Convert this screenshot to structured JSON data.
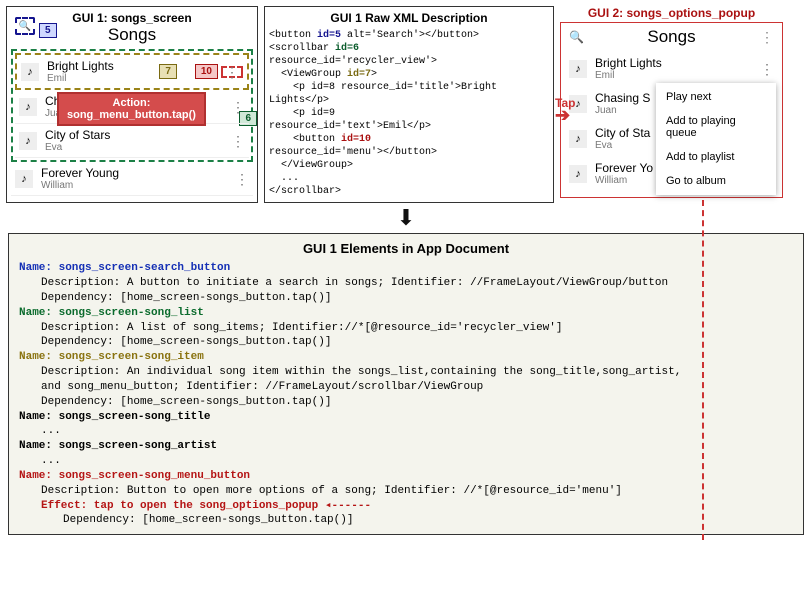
{
  "gui1": {
    "title": "GUI 1: songs_screen",
    "subtitle": "Songs",
    "badges": {
      "b5": "5",
      "b7": "7",
      "b10": "10",
      "b6": "6"
    },
    "action_label": "Action:\nsong_menu_button.tap()",
    "songs": [
      {
        "title": "Bright Lights",
        "artist": "Emil"
      },
      {
        "title": "Chasing Shadows",
        "artist": "Juan"
      },
      {
        "title": "City of Stars",
        "artist": "Eva"
      },
      {
        "title": "Forever Young",
        "artist": "William"
      }
    ]
  },
  "xml": {
    "title": "GUI 1 Raw XML Description",
    "l1a": "<button ",
    "l1b": "id=5",
    "l1c": " alt='Search'></button>",
    "l2a": "<scrollbar ",
    "l2b": "id=6",
    "l3": "resource_id='recycler_view'>",
    "l4a": "  <ViewGroup ",
    "l4b": "id=7",
    "l4c": ">",
    "l5": "    <p id=8 resource_id='title'>Bright",
    "l6": "Lights</p>",
    "l7": "    <p id=9",
    "l8": "resource_id='text'>Emil</p>",
    "l9a": "    <button ",
    "l9b": "id=10",
    "l10": "resource_id='menu'></button>",
    "l11": "  </ViewGroup>",
    "l12": "  ...",
    "l13": "</scrollbar>"
  },
  "tap_label": "Tap",
  "gui2": {
    "label": "GUI 2: songs_options_popup",
    "subtitle": "Songs",
    "songs": [
      {
        "title": "Bright Lights",
        "artist": "Emil"
      },
      {
        "title": "Chasing S",
        "artist": "Juan"
      },
      {
        "title": "City of Sta",
        "artist": "Eva"
      },
      {
        "title": "Forever Yo",
        "artist": "William"
      }
    ],
    "popup": [
      "Play next",
      "Add to playing queue",
      "Add to playlist",
      "Go to album"
    ]
  },
  "doc": {
    "title": "GUI 1 Elements in App Document",
    "e1": {
      "name": "Name: songs_screen-search_button",
      "desc": "Description: A button to initiate a search in songs; Identifier: //FrameLayout/ViewGroup/button",
      "dep": "Dependency: [home_screen-songs_button.tap()]"
    },
    "e2": {
      "name": "Name: songs_screen-song_list",
      "desc": "Description: A list of song_items; Identifier://*[@resource_id='recycler_view']",
      "dep": "Dependency: [home_screen-songs_button.tap()]"
    },
    "e3": {
      "name": "Name: songs_screen-song_item",
      "desc": "Description: An individual song item within the songs_list,containing the song_title,song_artist,",
      "desc2": "and song_menu_button; Identifier: //FrameLayout/scrollbar/ViewGroup",
      "dep": "Dependency: [home_screen-songs_button.tap()]"
    },
    "e4": {
      "name": "Name: songs_screen-song_title",
      "dots": "..."
    },
    "e5": {
      "name": "Name: songs_screen-song_artist",
      "dots": "..."
    },
    "e6": {
      "name": "Name: songs_screen-song_menu_button",
      "desc": "Description: Button to open more options of a song; Identifier: //*[@resource_id='menu']",
      "effect": "Effect: tap to open the song_options_popup  ◂------",
      "dep": "Dependency: [home_screen-songs_button.tap()]"
    }
  }
}
